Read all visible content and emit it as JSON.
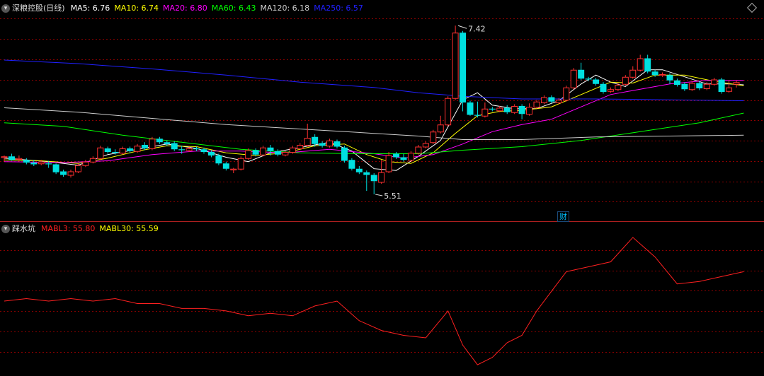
{
  "upper_legend": {
    "stock": "深粮控股(日线)",
    "items": [
      {
        "label": "MA5: 6.76",
        "color": "#ffffff"
      },
      {
        "label": "MA10: 6.74",
        "color": "#ffff00"
      },
      {
        "label": "MA20: 6.80",
        "color": "#ff00ff"
      },
      {
        "label": "MA60: 6.43",
        "color": "#00ff00"
      },
      {
        "label": "MA120: 6.18",
        "color": "#cccccc"
      },
      {
        "label": "MA250: 6.57",
        "color": "#2020ff"
      }
    ]
  },
  "lower_legend": {
    "indicator": "踩水坑",
    "items": [
      {
        "label": "MABL3: 55.80",
        "color": "#ff2020"
      },
      {
        "label": "MABL30: 55.59",
        "color": "#ffff00"
      }
    ]
  },
  "annotations": {
    "high": "7.42",
    "low": "5.51",
    "finance_marker": "财"
  },
  "colors": {
    "up": "#ff3030",
    "down": "#00e0e0",
    "grid": "#8b0000",
    "bg": "#000000"
  },
  "chart_data": [
    {
      "type": "candlestick",
      "title": "深粮控股(日线)",
      "ylim": [
        5.35,
        7.55
      ],
      "candles": [
        [
          5.93,
          5.94,
          5.88,
          5.95
        ],
        [
          5.94,
          5.9,
          5.89,
          5.97
        ],
        [
          5.91,
          5.92,
          5.88,
          5.95
        ],
        [
          5.9,
          5.87,
          5.85,
          5.92
        ],
        [
          5.87,
          5.85,
          5.83,
          5.9
        ],
        [
          5.86,
          5.88,
          5.84,
          5.9
        ],
        [
          5.86,
          5.85,
          5.81,
          5.89
        ],
        [
          5.85,
          5.76,
          5.74,
          5.86
        ],
        [
          5.77,
          5.73,
          5.71,
          5.79
        ],
        [
          5.73,
          5.77,
          5.7,
          5.79
        ],
        [
          5.77,
          5.84,
          5.75,
          5.86
        ],
        [
          5.84,
          5.88,
          5.82,
          5.9
        ],
        [
          5.88,
          5.92,
          5.86,
          5.94
        ],
        [
          5.92,
          6.04,
          5.9,
          6.06
        ],
        [
          6.03,
          5.99,
          5.97,
          6.05
        ],
        [
          5.99,
          5.98,
          5.96,
          6.02
        ],
        [
          5.98,
          6.03,
          5.96,
          6.05
        ],
        [
          6.03,
          6.0,
          5.98,
          6.05
        ],
        [
          6.0,
          6.06,
          5.98,
          6.08
        ],
        [
          6.07,
          6.03,
          6.01,
          6.1
        ],
        [
          6.03,
          6.14,
          6.01,
          6.16
        ],
        [
          6.14,
          6.1,
          6.08,
          6.16
        ],
        [
          6.1,
          6.08,
          6.06,
          6.12
        ],
        [
          6.09,
          6.02,
          6.0,
          6.11
        ],
        [
          6.02,
          6.01,
          5.97,
          6.06
        ],
        [
          6.01,
          6.03,
          5.99,
          6.05
        ],
        [
          6.03,
          6.02,
          6.0,
          6.05
        ],
        [
          6.02,
          5.99,
          5.97,
          6.04
        ],
        [
          5.99,
          5.95,
          5.93,
          6.01
        ],
        [
          5.95,
          5.86,
          5.84,
          5.97
        ],
        [
          5.86,
          5.8,
          5.78,
          5.88
        ],
        [
          5.79,
          5.8,
          5.75,
          5.81
        ],
        [
          5.8,
          5.92,
          5.78,
          5.94
        ],
        [
          5.92,
          6.01,
          5.9,
          6.03
        ],
        [
          6.01,
          5.96,
          5.94,
          6.03
        ],
        [
          5.96,
          6.04,
          5.94,
          6.06
        ],
        [
          6.04,
          6.0,
          5.95,
          6.07
        ],
        [
          6.0,
          5.96,
          5.94,
          6.02
        ],
        [
          5.96,
          5.99,
          5.94,
          6.0
        ],
        [
          5.99,
          6.04,
          5.97,
          6.06
        ],
        [
          6.03,
          6.07,
          6.01,
          6.09
        ],
        [
          6.07,
          6.15,
          6.05,
          6.31
        ],
        [
          6.16,
          6.08,
          6.05,
          6.19
        ],
        [
          6.09,
          6.06,
          6.04,
          6.11
        ],
        [
          6.06,
          6.12,
          6.04,
          6.14
        ],
        [
          6.11,
          6.05,
          6.03,
          6.13
        ],
        [
          6.04,
          5.89,
          5.87,
          6.06
        ],
        [
          5.9,
          5.8,
          5.78,
          5.92
        ],
        [
          5.8,
          5.76,
          5.74,
          5.83
        ],
        [
          5.76,
          5.73,
          5.55,
          5.78
        ],
        [
          5.73,
          5.66,
          5.51,
          5.75
        ],
        [
          5.65,
          5.76,
          5.63,
          5.9
        ],
        [
          5.77,
          5.95,
          5.75,
          5.99
        ],
        [
          5.97,
          5.93,
          5.91,
          5.99
        ],
        [
          5.93,
          5.9,
          5.88,
          5.97
        ],
        [
          5.9,
          5.98,
          5.88,
          6.0
        ],
        [
          5.98,
          6.05,
          5.96,
          6.07
        ],
        [
          6.05,
          6.09,
          6.03,
          6.11
        ],
        [
          6.1,
          6.22,
          6.08,
          6.24
        ],
        [
          6.22,
          6.3,
          6.2,
          6.4
        ],
        [
          6.3,
          6.6,
          6.28,
          6.62
        ],
        [
          6.6,
          7.34,
          6.58,
          7.42
        ],
        [
          7.34,
          6.55,
          6.45,
          7.36
        ],
        [
          6.55,
          6.41,
          6.4,
          6.57
        ],
        [
          6.41,
          6.4,
          6.38,
          6.56
        ],
        [
          6.4,
          6.48,
          6.38,
          6.55
        ],
        [
          6.48,
          6.47,
          6.45,
          6.5
        ],
        [
          6.46,
          6.49,
          6.44,
          6.51
        ],
        [
          6.49,
          6.44,
          6.42,
          6.52
        ],
        [
          6.44,
          6.51,
          6.42,
          6.53
        ],
        [
          6.51,
          6.42,
          6.36,
          6.53
        ],
        [
          6.42,
          6.5,
          6.4,
          6.54
        ],
        [
          6.5,
          6.56,
          6.48,
          6.58
        ],
        [
          6.55,
          6.61,
          6.53,
          6.63
        ],
        [
          6.61,
          6.56,
          6.54,
          6.63
        ],
        [
          6.55,
          6.58,
          6.53,
          6.6
        ],
        [
          6.58,
          6.72,
          6.56,
          6.74
        ],
        [
          6.72,
          6.92,
          6.7,
          6.94
        ],
        [
          6.92,
          6.82,
          6.8,
          7.0
        ],
        [
          6.82,
          6.81,
          6.79,
          6.84
        ],
        [
          6.81,
          6.76,
          6.74,
          6.83
        ],
        [
          6.76,
          6.67,
          6.65,
          6.78
        ],
        [
          6.68,
          6.7,
          6.66,
          6.72
        ],
        [
          6.7,
          6.75,
          6.68,
          6.77
        ],
        [
          6.76,
          6.84,
          6.74,
          6.86
        ],
        [
          6.84,
          6.92,
          6.82,
          6.96
        ],
        [
          6.92,
          7.05,
          6.9,
          7.09
        ],
        [
          7.05,
          6.9,
          6.88,
          7.09
        ],
        [
          6.9,
          6.86,
          6.84,
          6.92
        ],
        [
          6.86,
          6.87,
          6.84,
          6.89
        ],
        [
          6.86,
          6.8,
          6.76,
          6.88
        ],
        [
          6.8,
          6.75,
          6.73,
          6.82
        ],
        [
          6.76,
          6.7,
          6.68,
          6.78
        ],
        [
          6.7,
          6.77,
          6.68,
          6.79
        ],
        [
          6.77,
          6.71,
          6.69,
          6.79
        ],
        [
          6.71,
          6.76,
          6.69,
          6.78
        ],
        [
          6.76,
          6.81,
          6.74,
          6.83
        ],
        [
          6.81,
          6.67,
          6.65,
          6.83
        ],
        [
          6.68,
          6.72,
          6.66,
          6.8
        ],
        [
          6.76,
          6.78,
          6.72,
          6.8
        ]
      ],
      "ma": [
        {
          "name": "MA5",
          "color": "#ffffff",
          "points": [
            [
              0,
              5.92
            ],
            [
              6,
              5.88
            ],
            [
              10,
              5.84
            ],
            [
              14,
              5.96
            ],
            [
              18,
              6.02
            ],
            [
              22,
              6.08
            ],
            [
              26,
              6.03
            ],
            [
              30,
              5.93
            ],
            [
              33,
              5.88
            ],
            [
              36,
              5.98
            ],
            [
              40,
              6.04
            ],
            [
              44,
              6.1
            ],
            [
              47,
              6.0
            ],
            [
              50,
              5.8
            ],
            [
              53,
              5.78
            ],
            [
              56,
              5.94
            ],
            [
              59,
              6.12
            ],
            [
              62,
              6.58
            ],
            [
              64,
              6.66
            ],
            [
              66,
              6.52
            ],
            [
              69,
              6.48
            ],
            [
              72,
              6.48
            ],
            [
              75,
              6.57
            ],
            [
              78,
              6.76
            ],
            [
              80,
              6.86
            ],
            [
              82,
              6.78
            ],
            [
              84,
              6.73
            ],
            [
              87,
              6.92
            ],
            [
              89,
              6.92
            ],
            [
              92,
              6.84
            ],
            [
              95,
              6.76
            ],
            [
              98,
              6.76
            ],
            [
              100,
              6.75
            ]
          ]
        },
        {
          "name": "MA10",
          "color": "#ffff00",
          "points": [
            [
              0,
              5.9
            ],
            [
              5,
              5.89
            ],
            [
              10,
              5.86
            ],
            [
              14,
              5.92
            ],
            [
              18,
              6.0
            ],
            [
              22,
              6.06
            ],
            [
              26,
              6.05
            ],
            [
              30,
              5.98
            ],
            [
              34,
              5.95
            ],
            [
              38,
              5.98
            ],
            [
              42,
              6.06
            ],
            [
              46,
              6.08
            ],
            [
              49,
              5.96
            ],
            [
              52,
              5.88
            ],
            [
              55,
              5.86
            ],
            [
              58,
              5.98
            ],
            [
              61,
              6.2
            ],
            [
              64,
              6.4
            ],
            [
              67,
              6.45
            ],
            [
              70,
              6.46
            ],
            [
              74,
              6.5
            ],
            [
              78,
              6.64
            ],
            [
              82,
              6.78
            ],
            [
              85,
              6.77
            ],
            [
              88,
              6.86
            ],
            [
              92,
              6.86
            ],
            [
              96,
              6.79
            ],
            [
              100,
              6.74
            ]
          ]
        },
        {
          "name": "MA20",
          "color": "#ff00ff",
          "points": [
            [
              0,
              5.88
            ],
            [
              8,
              5.87
            ],
            [
              14,
              5.89
            ],
            [
              20,
              5.96
            ],
            [
              26,
              6.0
            ],
            [
              32,
              6.0
            ],
            [
              38,
              5.98
            ],
            [
              44,
              6.02
            ],
            [
              50,
              5.97
            ],
            [
              54,
              5.92
            ],
            [
              58,
              5.96
            ],
            [
              62,
              6.08
            ],
            [
              66,
              6.22
            ],
            [
              70,
              6.3
            ],
            [
              74,
              6.36
            ],
            [
              78,
              6.5
            ],
            [
              82,
              6.64
            ],
            [
              86,
              6.7
            ],
            [
              90,
              6.76
            ],
            [
              95,
              6.8
            ],
            [
              100,
              6.8
            ]
          ]
        },
        {
          "name": "MA60",
          "color": "#00ff00",
          "points": [
            [
              0,
              6.32
            ],
            [
              8,
              6.28
            ],
            [
              16,
              6.18
            ],
            [
              24,
              6.1
            ],
            [
              32,
              6.02
            ],
            [
              40,
              5.98
            ],
            [
              48,
              5.97
            ],
            [
              56,
              5.97
            ],
            [
              62,
              6.01
            ],
            [
              70,
              6.05
            ],
            [
              78,
              6.12
            ],
            [
              86,
              6.22
            ],
            [
              94,
              6.32
            ],
            [
              100,
              6.43
            ]
          ]
        },
        {
          "name": "MA120",
          "color": "#cccccc",
          "points": [
            [
              0,
              6.49
            ],
            [
              10,
              6.44
            ],
            [
              20,
              6.37
            ],
            [
              30,
              6.3
            ],
            [
              40,
              6.25
            ],
            [
              50,
              6.2
            ],
            [
              56,
              6.17
            ],
            [
              62,
              6.13
            ],
            [
              70,
              6.13
            ],
            [
              80,
              6.16
            ],
            [
              90,
              6.17
            ],
            [
              100,
              6.18
            ]
          ]
        },
        {
          "name": "MA250",
          "color": "#2020ff",
          "points": [
            [
              0,
              7.03
            ],
            [
              10,
              6.99
            ],
            [
              20,
              6.93
            ],
            [
              30,
              6.86
            ],
            [
              40,
              6.78
            ],
            [
              50,
              6.72
            ],
            [
              56,
              6.66
            ],
            [
              62,
              6.62
            ],
            [
              70,
              6.59
            ],
            [
              80,
              6.59
            ],
            [
              90,
              6.58
            ],
            [
              100,
              6.57
            ]
          ]
        }
      ]
    },
    {
      "type": "line",
      "title": "踩水坑",
      "ylim": [
        20,
        80
      ],
      "series": [
        {
          "name": "MABL3",
          "color": "#ff2020",
          "x": [
            0,
            3,
            6,
            9,
            12,
            15,
            18,
            21,
            24,
            27,
            30,
            33,
            36,
            39,
            42,
            45,
            48,
            51,
            54,
            57,
            60,
            62,
            64,
            66,
            68,
            70,
            72,
            74,
            76,
            79,
            82,
            85,
            88,
            91,
            94,
            97,
            100
          ],
          "values": [
            50,
            51,
            50,
            51,
            50,
            51,
            49,
            49,
            47,
            47,
            46,
            44,
            45,
            44,
            48,
            50,
            42,
            38,
            36,
            35,
            46,
            32,
            24,
            27,
            33,
            36,
            46,
            54,
            62,
            64,
            66,
            76,
            68,
            57,
            58,
            60,
            62
          ]
        },
        {
          "name": "MABL30",
          "color": "#ffff00",
          "x": [],
          "values": []
        }
      ]
    }
  ]
}
